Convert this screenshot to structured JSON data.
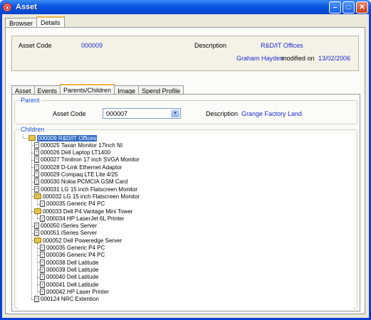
{
  "window": {
    "title": "Asset"
  },
  "outer_tabs": [
    {
      "label": "Browser"
    },
    {
      "label": "Details"
    }
  ],
  "summary": {
    "asset_code_label": "Asset Code",
    "asset_code_value": "000009",
    "description_label": "Description",
    "description_value": "R&D/IT Offices",
    "modified_user": "Graham Hayden",
    "modified_text": "modified on",
    "modified_date": "13/02/2006"
  },
  "sub_tabs": [
    {
      "label": "Asset"
    },
    {
      "label": "Events"
    },
    {
      "label": "Parents/Children"
    },
    {
      "label": "Image"
    },
    {
      "label": "Spend Profile"
    }
  ],
  "parent": {
    "legend": "Parent",
    "asset_code_label": "Asset Code",
    "asset_code_value": "000007",
    "description_label": "Description",
    "description_value": "Grange Factory Land"
  },
  "children": {
    "legend": "Children",
    "tree": [
      {
        "label": "000009 R&D/IT Offices",
        "level": 0,
        "folder": true,
        "selected": true
      },
      {
        "label": "000025 Taxan Monitor 17inch NI",
        "level": 1,
        "folder": false
      },
      {
        "label": "000026 Dell Laptop LT1400",
        "level": 1,
        "folder": false
      },
      {
        "label": "000027 Trinitron 17 inch SVGA Monitor",
        "level": 1,
        "folder": false
      },
      {
        "label": "000028 D-Link Ethernet Adaptor",
        "level": 1,
        "folder": false
      },
      {
        "label": "000029 Compaq LTE Lite 4/25",
        "level": 1,
        "folder": false
      },
      {
        "label": "000030 Nokia PCMCIA GSM Card",
        "level": 1,
        "folder": false
      },
      {
        "label": "000031 LG 15 inch Flatscreen Monitor",
        "level": 1,
        "folder": false
      },
      {
        "label": "000032 LG 15 inch Flatscreen Monitor",
        "level": 1,
        "folder": true
      },
      {
        "label": "000035 Generic P4 PC",
        "level": 2,
        "folder": false
      },
      {
        "label": "000033 Dell P4 Vantage Mini Tower",
        "level": 1,
        "folder": true
      },
      {
        "label": "000034 HP LaserJet 6L Printer",
        "level": 2,
        "folder": false
      },
      {
        "label": "000050 iSeries Server",
        "level": 1,
        "folder": false
      },
      {
        "label": "000051 iSeries Server",
        "level": 1,
        "folder": false
      },
      {
        "label": "000052 Dell Poweredge Server",
        "level": 1,
        "folder": true
      },
      {
        "label": "000035 Generic P4 PC",
        "level": 2,
        "folder": false
      },
      {
        "label": "000036 Generic P4 PC",
        "level": 2,
        "folder": false
      },
      {
        "label": "000038 Dell Latitude",
        "level": 2,
        "folder": false
      },
      {
        "label": "000039 Dell Latitude",
        "level": 2,
        "folder": false
      },
      {
        "label": "000040 Dell Latitude",
        "level": 2,
        "folder": false
      },
      {
        "label": "000041 Dell Latitude",
        "level": 2,
        "folder": false
      },
      {
        "label": "000042 HP Laser Printer",
        "level": 2,
        "folder": false
      },
      {
        "label": "000124 NRC Extention",
        "level": 1,
        "folder": false
      }
    ]
  },
  "colors": {
    "title_bar": "#0a55e0",
    "link_text": "#1c2ad6",
    "selection": "#316ac5",
    "panel": "#ece9d8"
  },
  "icons": {
    "app": "asset-app-icon",
    "minimize": "minimize-icon",
    "maximize": "maximize-icon",
    "close": "close-icon"
  }
}
